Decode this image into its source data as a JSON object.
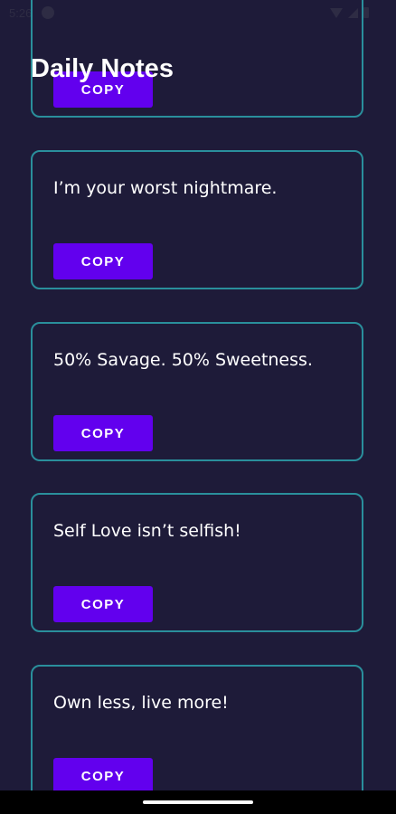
{
  "status_bar": {
    "time": "5:26"
  },
  "app": {
    "title": "Daily Notes"
  },
  "notes": [
    {
      "text": "",
      "copy_label": "COPY"
    },
    {
      "text": "I’m your worst nightmare.",
      "copy_label": "COPY"
    },
    {
      "text": "50% Savage. 50% Sweetness.",
      "copy_label": "COPY"
    },
    {
      "text": "Self Love isn’t selfish!",
      "copy_label": "COPY"
    },
    {
      "text": "Own less, live more!",
      "copy_label": "COPY"
    }
  ],
  "colors": {
    "background": "#1e1b39",
    "card_border": "#2a8f9c",
    "button": "#6200ee",
    "text": "#ffffff"
  },
  "icons": [
    "app-notification-icon",
    "wifi-icon",
    "signal-icon",
    "battery-icon"
  ]
}
